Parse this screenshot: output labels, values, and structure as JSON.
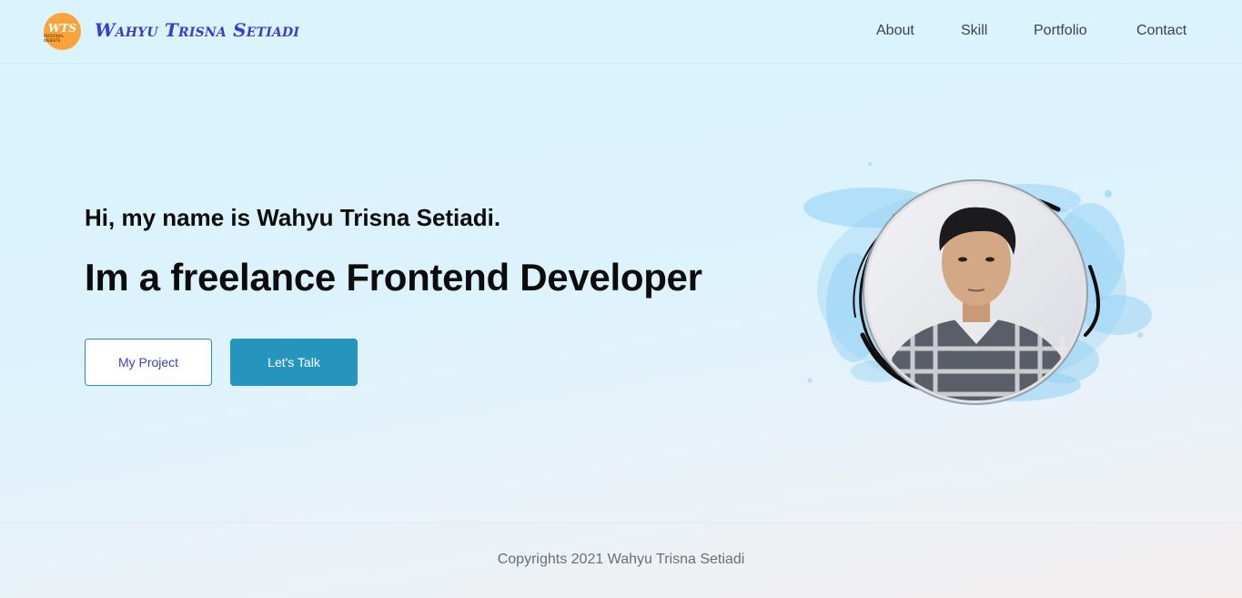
{
  "brand": {
    "logo_mark": "WTS",
    "logo_subtext": "PERSONAL WEBSITE",
    "name": "Wahyu Trisna Setiadi"
  },
  "nav": {
    "links": [
      "About",
      "Skill",
      "Portfolio",
      "Contact"
    ]
  },
  "hero": {
    "greeting": "Hi, my name is Wahyu Trisna Setiadi.",
    "headline": "Im a freelance Frontend Developer",
    "buttons": {
      "project": "My Project",
      "talk": "Let's Talk"
    },
    "portrait_icon": "profile-photo"
  },
  "footer": {
    "copyright": "Copyrights 2021 Wahyu Trisna Setiadi"
  },
  "colors": {
    "brand_text": "#3d3ad0",
    "logo_badge": "#f9a33a",
    "primary_button": "#2595bd",
    "splash_blue": "#8fd0f4"
  }
}
